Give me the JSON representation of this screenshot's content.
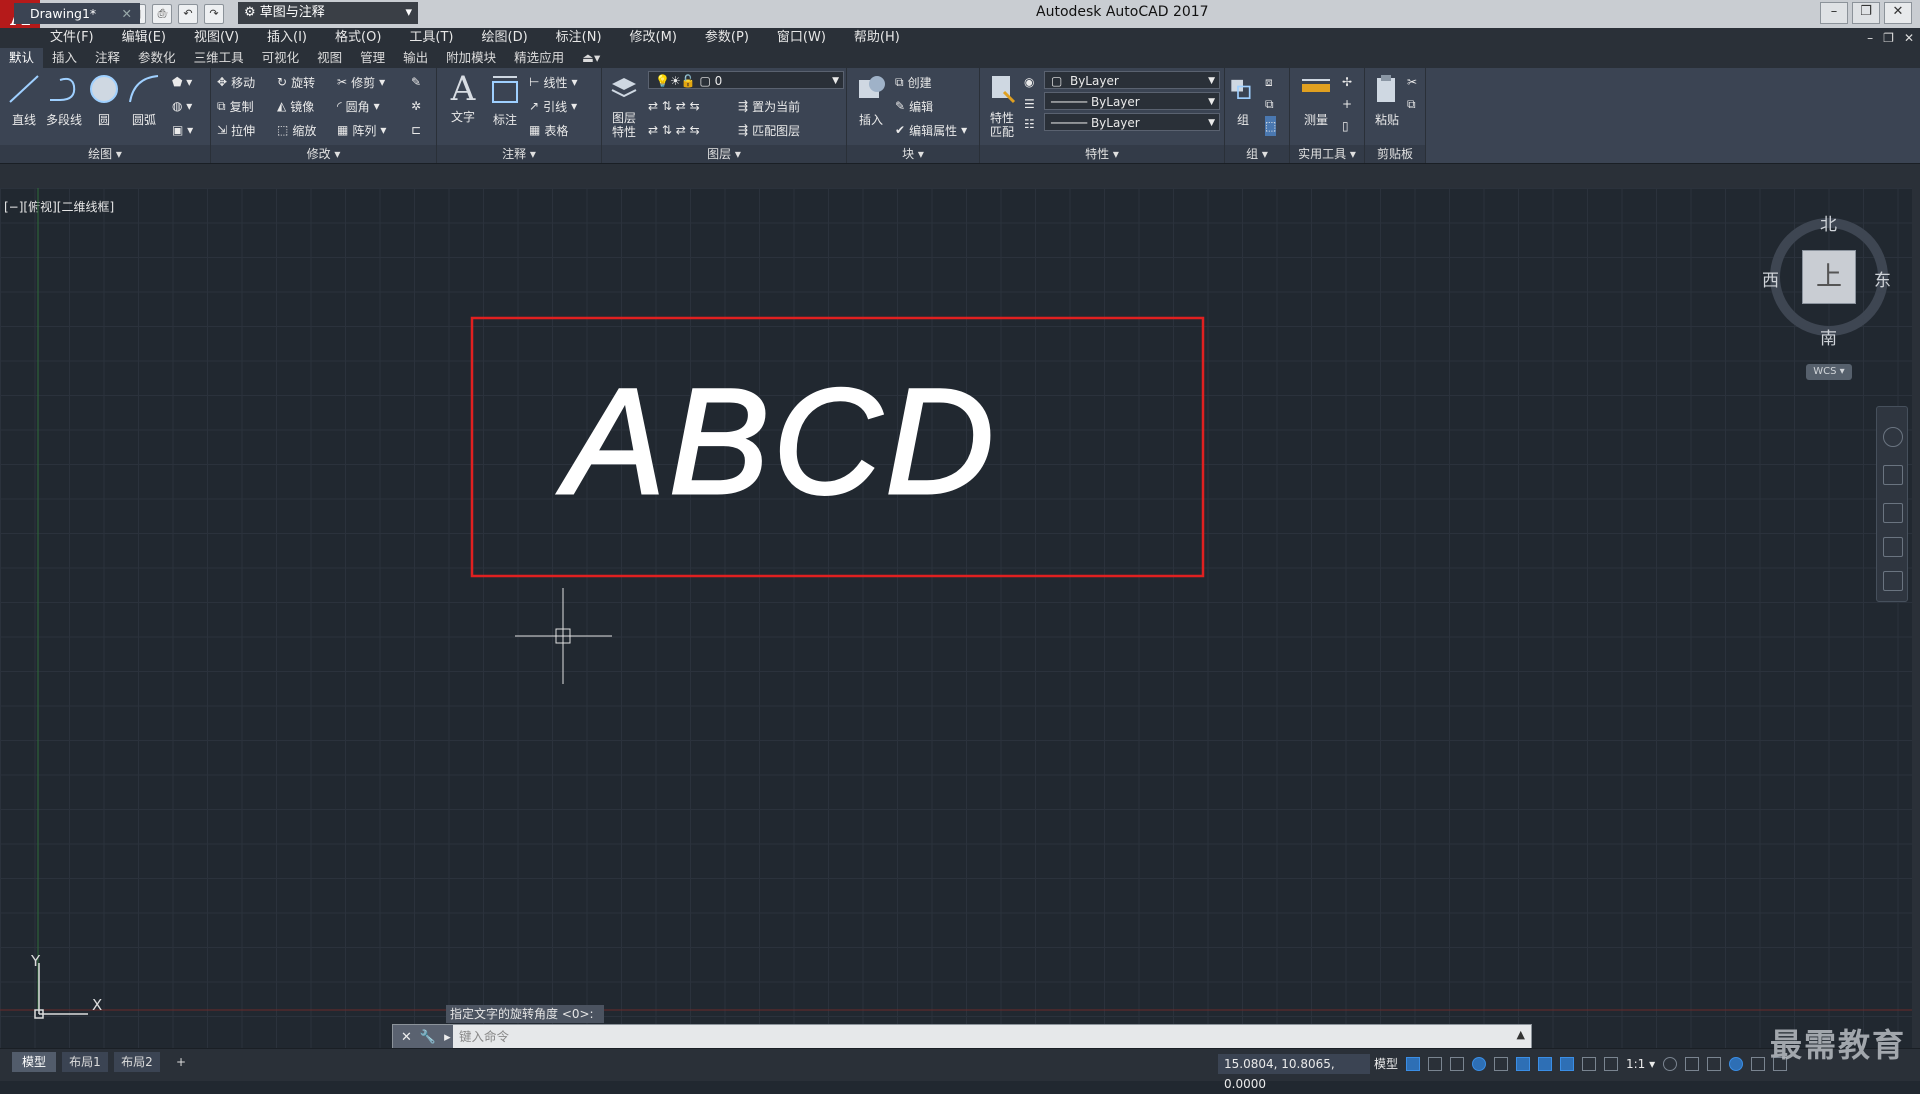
{
  "titlebar": {
    "logo_letter": "A",
    "workspace": "草图与注释",
    "app_title": "Autodesk AutoCAD 2017",
    "win_min": "–",
    "win_restore": "❐",
    "win_close": "✕"
  },
  "menu": [
    "文件(F)",
    "编辑(E)",
    "视图(V)",
    "插入(I)",
    "格式(O)",
    "工具(T)",
    "绘图(D)",
    "标注(N)",
    "修改(M)",
    "参数(P)",
    "窗口(W)",
    "帮助(H)"
  ],
  "ribbon_tabs": [
    "默认",
    "插入",
    "注释",
    "参数化",
    "三维工具",
    "可视化",
    "视图",
    "管理",
    "输出",
    "附加模块",
    "精选应用"
  ],
  "ribbon": {
    "draw": {
      "title": "绘图 ▾",
      "line": "直线",
      "polyline": "多段线",
      "circle": "圆",
      "arc": "圆弧"
    },
    "modify": {
      "title": "修改 ▾",
      "move": "移动",
      "rotate": "旋转",
      "trim": "修剪",
      "copy": "复制",
      "mirror": "镜像",
      "fillet": "圆角",
      "stretch": "拉伸",
      "scale": "缩放",
      "array": "阵列"
    },
    "annotation": {
      "title": "注释 ▾",
      "text": "文字",
      "dimension": "标注",
      "linear": "线性",
      "leader": "引线",
      "table": "表格"
    },
    "layers": {
      "title": "图层 ▾",
      "layer_props": "图层\n特性",
      "layer_value": "0",
      "set_current": "置为当前",
      "match_layer": "匹配图层"
    },
    "block": {
      "title": "块 ▾",
      "insert": "插入",
      "create": "创建",
      "edit": "编辑",
      "edit_attr": "编辑属性"
    },
    "properties": {
      "title": "特性 ▾",
      "match": "特性\n匹配",
      "color": "ByLayer",
      "linetype": "ByLayer",
      "lineweight": "ByLayer"
    },
    "group": {
      "title": "组 ▾",
      "group": "组"
    },
    "utilities": {
      "title": "实用工具 ▾",
      "measure": "测量"
    },
    "clipboard": {
      "title": "剪贴板",
      "paste": "粘贴"
    }
  },
  "document": {
    "tab": "Drawing1*",
    "close": "✕",
    "new_tab": "+"
  },
  "viewport": {
    "label": "[−][俯视][二维线框]"
  },
  "drawing": {
    "text": "ABCD",
    "frame_color": "#e02020"
  },
  "viewcube": {
    "north": "北",
    "south": "南",
    "east": "东",
    "west": "西",
    "face": "上",
    "wcs": "WCS ▾"
  },
  "ucs": {
    "x": "X",
    "y": "Y"
  },
  "command": {
    "hint": "指定文字的旋转角度 <0>:",
    "placeholder": "键入命令"
  },
  "layout_tabs": [
    "模型",
    "布局1",
    "布局2",
    "+"
  ],
  "status": {
    "coords": "15.0804, 10.8065, 0.0000",
    "model": "模型",
    "scale": "1:1 ▾"
  },
  "watermark": "最需教育",
  "colors": {
    "canvas": "#212830",
    "ribbon": "#3b4453",
    "accent": "#b51a1a"
  }
}
